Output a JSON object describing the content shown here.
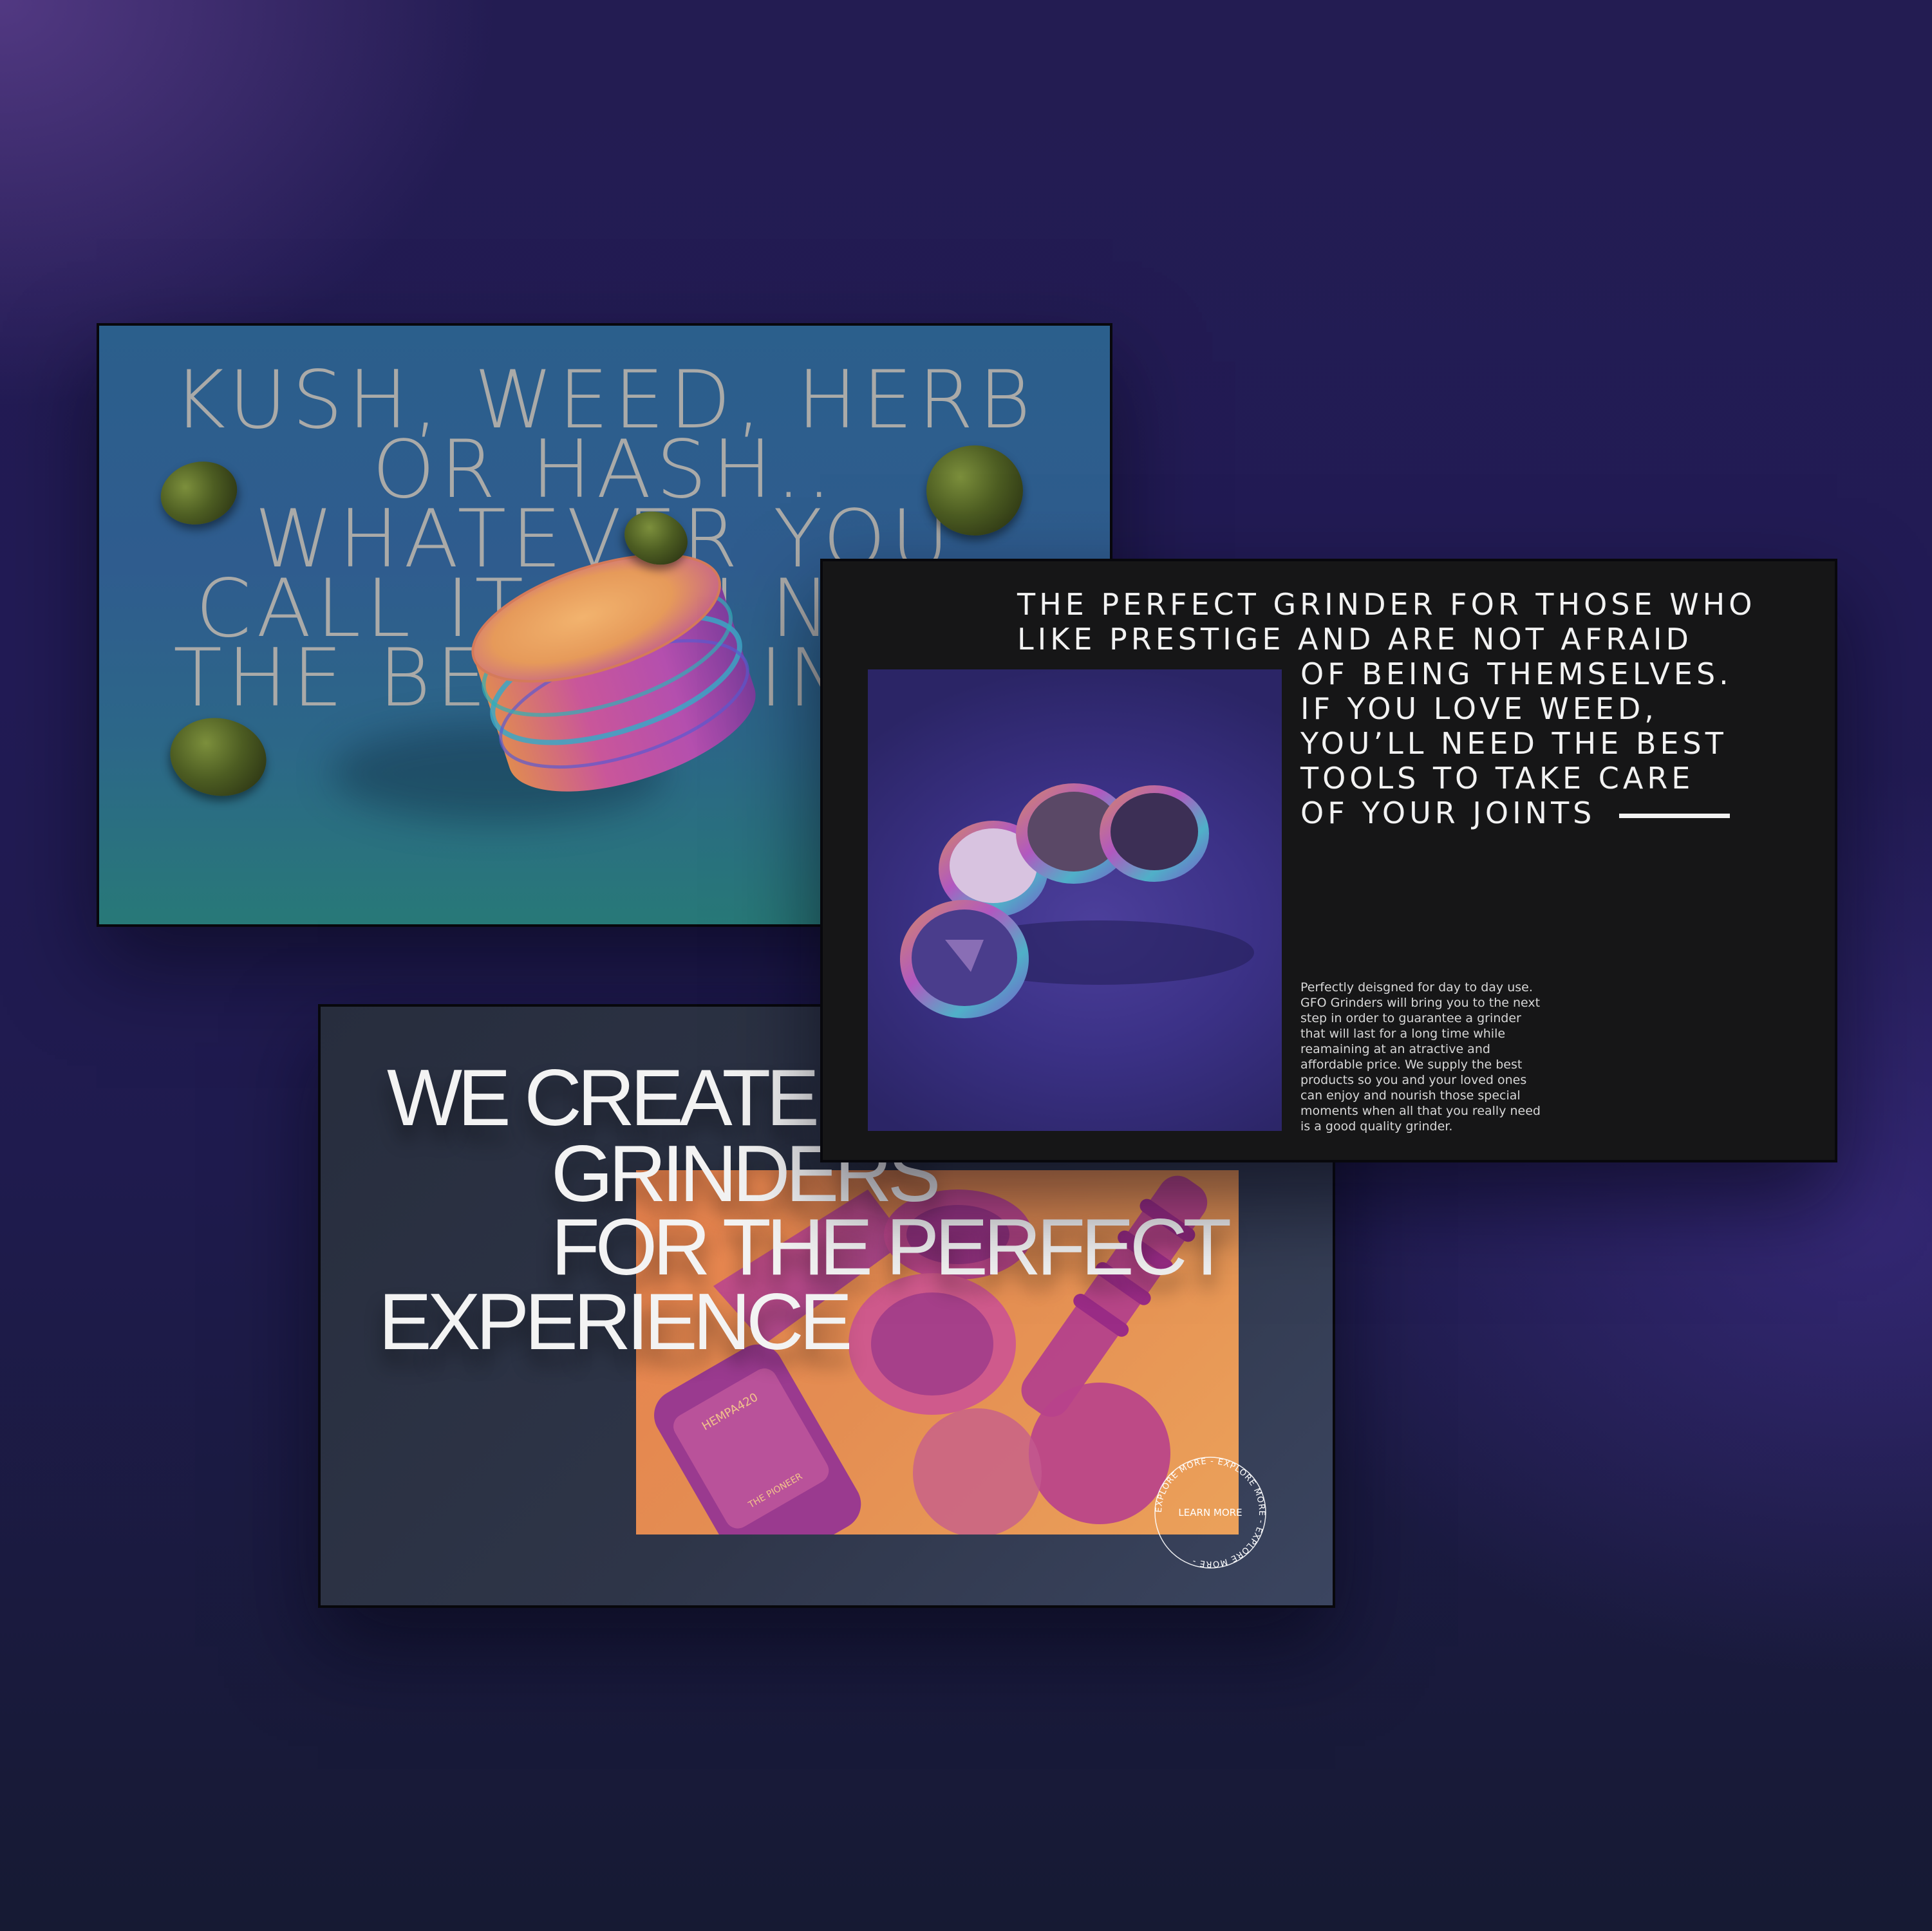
{
  "card1": {
    "lines": [
      "KUSH, WEED, HERB",
      "OR HASH..",
      "WHATEVER YOU",
      "CALL IT YOU NEED",
      "THE BEST GRINDER"
    ]
  },
  "card2": {
    "heading_lines": [
      "THE PERFECT GRINDER FOR THOSE WHO",
      "LIKE PRESTIGE AND ARE NOT AFRAID",
      "OF BEING THEMSELVES.",
      "IF YOU LOVE WEED,",
      "YOU’LL NEED THE BEST",
      "TOOLS TO TAKE CARE",
      "OF YOUR JOINTS"
    ],
    "body_lines": [
      "Perfectly deisgned for day to day use.",
      "GFO Grinders will bring you to the next",
      "step in order to guarantee a grinder",
      "that will last for a long time while",
      "reamaining at an atractive and",
      "affordable price. We supply the best",
      "products so you and your loved ones",
      "can enjoy and nourish those special",
      "moments when all that you really need",
      "is a good quality grinder."
    ]
  },
  "card3": {
    "headline_lines": [
      "WE CREATE",
      "GRINDERS",
      "FOR THE PERFECT",
      "EXPERIENCE"
    ],
    "badge_label": "LEARN MORE",
    "badge_ring_text": "EXPLORE MORE - EXPLORE MORE - EXPLORE MORE - ",
    "jar_label": "THE PIONEER",
    "jar_code": "HEMPA420"
  },
  "colors": {
    "background": "#221b55",
    "card1_bg": "#2c5f8c",
    "card2_bg": "#161617",
    "card3_bg": "#2e3548",
    "accent_orange": "#e58a4f",
    "accent_magenta": "#c23f9c"
  }
}
